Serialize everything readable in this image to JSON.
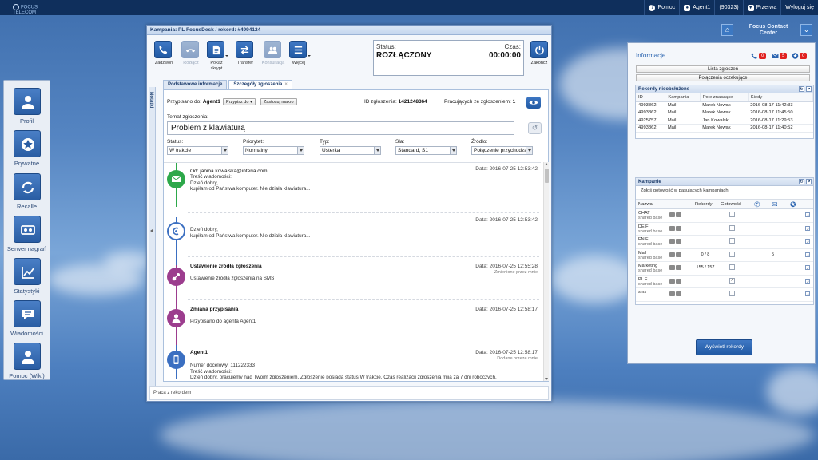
{
  "topbar": {
    "logo_text": "FOCUS TELECOM",
    "help": "Pomoc",
    "user": "Agent1",
    "user_ext": "(90323)",
    "break": "Przerwa",
    "logout": "Wyloguj się"
  },
  "fcc": {
    "title_line1": "Focus Contact",
    "title_line2": "Center"
  },
  "sidebar": {
    "items": [
      {
        "label": "Profil",
        "icon": "user-icon"
      },
      {
        "label": "Prywatne",
        "icon": "star-icon"
      },
      {
        "label": "Recalle",
        "icon": "recall-icon"
      },
      {
        "label": "Serwer nagrań",
        "icon": "tape-icon"
      },
      {
        "label": "Statystyki",
        "icon": "chart-icon"
      },
      {
        "label": "Wiadomości",
        "icon": "message-icon"
      },
      {
        "label": "Pomoc (Wiki)",
        "icon": "help-user-icon"
      }
    ]
  },
  "window": {
    "title": "Kampania: PL FocusDesk / rekord: #4994124",
    "toolbar": {
      "call": "Zadzwoń",
      "hangup": "Rozłącz",
      "script_l1": "Pokaż",
      "script_l2": "skrypt",
      "transfer": "Transfer",
      "consult": "Konsultacja",
      "more": "Więcej",
      "end": "Zakończ"
    },
    "status": {
      "label": "Status:",
      "value": "ROZŁĄCZONY",
      "time_label": "Czas:",
      "time_value": "00:00:00"
    },
    "side_tab": "Notatki",
    "tabs": [
      {
        "label": "Podstawowe informacje"
      },
      {
        "label": "Szczegóły zgłoszenia",
        "close": "×"
      }
    ],
    "ticket": {
      "assigned_label": "Przypisano do:",
      "assigned_value": "Agent1",
      "assign_btn": "Przypisz do",
      "macro_btn": "Zastosuj makro",
      "id_label": "ID zgłoszenia:",
      "id_value": "1421248364",
      "workers_label": "Pracujących ze zgłoszeniem:",
      "workers_value": "1",
      "subject_label": "Temat zgłoszenia:",
      "subject_value": "Problem z klawiaturą",
      "fields": [
        {
          "label": "Status:",
          "value": "W trakcie"
        },
        {
          "label": "Priorytet:",
          "value": "Normalny"
        },
        {
          "label": "Typ:",
          "value": "Usterka"
        },
        {
          "label": "Sla:",
          "value": "Standard, S1"
        },
        {
          "label": "Źródło:",
          "value": "Połączenie przychodzą"
        }
      ]
    },
    "timeline": [
      {
        "title": "Od: janina.kowalska@interia.com",
        "date": "Data: 2016-07-25 12:53:42",
        "sub": "",
        "body": "Treść wiadomości:\nDzień dobry,\nkupiłam od Państwa komputer. Nie działa klawiatura...",
        "icon": "mail-icon",
        "color": "#2da84a"
      },
      {
        "title": "",
        "date": "Data: 2016-07-25 12:53:42",
        "sub": "",
        "body": "Dzień dobry,\nkupiłam od Państwa komputer. Nie działa klawiatura...",
        "icon": "reply-icon",
        "color": "#3b6fc1"
      },
      {
        "title": "Ustawienie źródła zgłoszenia",
        "date": "Data: 2016-07-25 12:55:28",
        "sub": "Zmienione przez mnie",
        "body": "Ustawienie źródła zgłoszenia na SMS",
        "icon": "source-icon",
        "color": "#9c3d8e"
      },
      {
        "title": "Zmiana przypisania",
        "date": "Data: 2016-07-25 12:58:17",
        "sub": "",
        "body": "Przypisano do agenta Agent1",
        "icon": "person-icon",
        "color": "#9c3d8e"
      },
      {
        "title": "Agent1",
        "date": "Data: 2016-07-25 12:58:17",
        "sub": "Dodane przeze mnie",
        "body": "Numer docelowy: 111222333\nTreść wiadomości:\nDzień dobry, pracujemy nad Twoim zgłoszeniem. Zgłoszenie posiada status W trakcie. Czas realizacji zgłoszenia mija za 7 dni roboczych.",
        "icon": "phone-icon",
        "color": "#3b6fc1"
      }
    ],
    "footer": "Praca z rekordem"
  },
  "right_panel": {
    "title": "Informacje",
    "counters": [
      {
        "icon": "phone-icon",
        "value": "0"
      },
      {
        "icon": "mail-icon",
        "value": "5"
      },
      {
        "icon": "star-icon",
        "value": "0"
      }
    ],
    "btn_tickets": "Lista zgłoszeń",
    "btn_waiting": "Połączenia oczekujące",
    "unhandled": {
      "title": "Rekordy nieobsłużone",
      "columns": [
        "ID",
        "Kampania",
        "Pole znaczące",
        "Kiedy"
      ],
      "rows": [
        [
          "4993862",
          "Mail",
          "Marek Nowak",
          "2016-08-17 11:42:33"
        ],
        [
          "4993862",
          "Mail",
          "Marek Nowak",
          "2016-08-17 11:45:50"
        ],
        [
          "4925757",
          "Mail",
          "Jan Kowalski",
          "2016-08-17 11:29:53"
        ],
        [
          "4993862",
          "Mail",
          "Marek Nowak",
          "2016-08-17 11:40:52"
        ]
      ]
    },
    "campaigns": {
      "title": "Kampanie",
      "hint": "Zgłoś gotowość w pasujących kampaniach",
      "col_name": "Nazwa",
      "col_records": "Rekordy",
      "col_ready": "Gotowość",
      "rows": [
        {
          "name": "CHAT",
          "sub": "shared base",
          "records": "",
          "ready": "",
          "mail": ""
        },
        {
          "name": "DE F",
          "sub": "shared base",
          "records": "",
          "ready": "",
          "mail": ""
        },
        {
          "name": "EN F",
          "sub": "shared base",
          "records": "",
          "ready": "",
          "mail": ""
        },
        {
          "name": "Mail",
          "sub": "shared base",
          "records": "0 / 8",
          "ready": "",
          "mail": "5"
        },
        {
          "name": "Marketing",
          "sub": "shared base",
          "records": "155 / 157",
          "ready": "",
          "mail": ""
        },
        {
          "name": "PL F",
          "sub": "shared base",
          "records": "",
          "ready": "✓",
          "mail": ""
        },
        {
          "name": "sms",
          "sub": "",
          "records": "",
          "ready": "",
          "mail": ""
        }
      ]
    },
    "show_btn": "Wyświetl rekordy"
  }
}
